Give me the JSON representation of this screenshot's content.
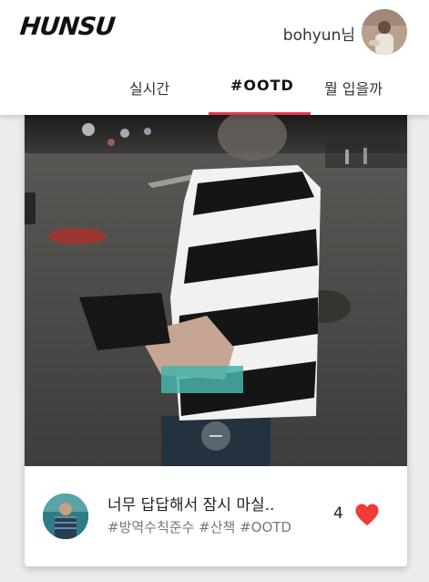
{
  "header": {
    "logo": "HUNSU",
    "user_name": "bohyun님"
  },
  "tabs": [
    {
      "label": "실시간",
      "active": false
    },
    {
      "label": "#OOTD",
      "active": true
    },
    {
      "label": "뭘 입을까",
      "active": false
    }
  ],
  "colors": {
    "accent": "#e8344e",
    "heart": "#f03b3b"
  },
  "post": {
    "title": "너무 답답해서 잠시 마실..",
    "tags": "#방역수칙준수 #산책 #OOTD",
    "likes": "4",
    "like_icon": "heart-icon"
  }
}
